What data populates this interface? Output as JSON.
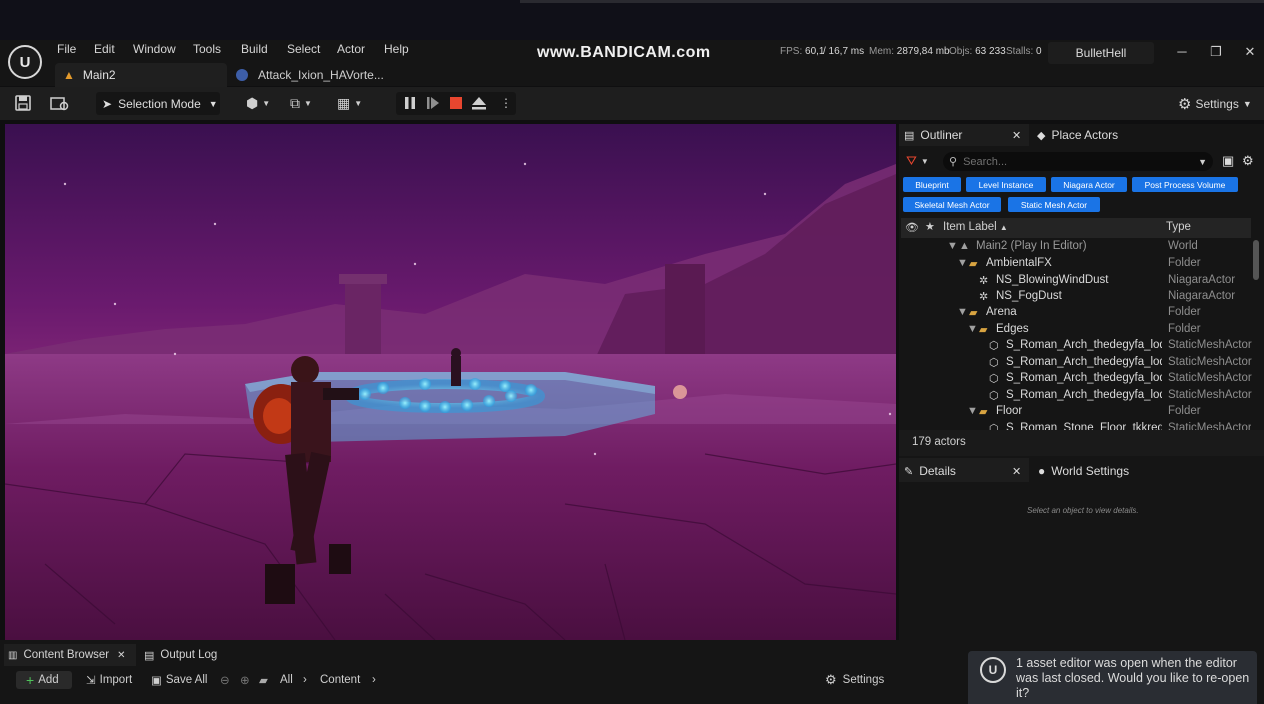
{
  "menu": [
    "File",
    "Edit",
    "Window",
    "Tools",
    "Build",
    "Select",
    "Actor",
    "Help"
  ],
  "tabs": {
    "main": "Main2",
    "attack": "Attack_Ixion_HAVorte..."
  },
  "watermark": "www.BANDICAM.com",
  "stats": {
    "fps_label": "FPS:",
    "fps": "60,1",
    "ms": "/ 16,7 ms",
    "mem_label": "Mem:",
    "mem": "2879,84 mb",
    "objs_label": "Objs:",
    "objs": "63 233",
    "stalls_label": "Stalls:",
    "stalls": "0"
  },
  "project_name": "BulletHell",
  "window_buttons": {
    "minimize": "─",
    "restore": "❐",
    "close": "✕"
  },
  "toolbar": {
    "selection_mode": "Selection Mode",
    "settings": "Settings"
  },
  "outliner": {
    "tab": "Outliner",
    "place_actors_tab": "Place Actors",
    "search_placeholder": "Search...",
    "filters_row1": [
      "Blueprint",
      "Level Instance",
      "Niagara Actor",
      "Post Process Volume"
    ],
    "filters_row2": [
      "Skeletal Mesh Actor",
      "Static Mesh Actor"
    ],
    "columns": {
      "label": "Item Label",
      "type": "Type"
    },
    "rows": [
      {
        "label": "Main2 (Play In Editor)",
        "type": "World"
      },
      {
        "label": "AmbientalFX",
        "type": "Folder"
      },
      {
        "label": "NS_BlowingWindDust",
        "type": "NiagaraActor"
      },
      {
        "label": "NS_FogDust",
        "type": "NiagaraActor"
      },
      {
        "label": "Arena",
        "type": "Folder"
      },
      {
        "label": "Edges",
        "type": "Folder"
      },
      {
        "label": "S_Roman_Arch_thedegyfa_lod",
        "type": "StaticMeshActor"
      },
      {
        "label": "S_Roman_Arch_thedegyfa_lod",
        "type": "StaticMeshActor"
      },
      {
        "label": "S_Roman_Arch_thedegyfa_lod",
        "type": "StaticMeshActor"
      },
      {
        "label": "S_Roman_Arch_thedegyfa_lod",
        "type": "StaticMeshActor"
      },
      {
        "label": "Floor",
        "type": "Folder"
      },
      {
        "label": "S_Roman_Stone_Floor_tkkrequ",
        "type": "StaticMeshActor"
      }
    ],
    "actor_count": "179 actors"
  },
  "details": {
    "tab": "Details",
    "world_settings_tab": "World Settings",
    "hint": "Select an object to view details."
  },
  "bottom": {
    "content_browser_tab": "Content Browser",
    "output_log_tab": "Output Log",
    "add": "Add",
    "import": "Import",
    "save_all": "Save All",
    "path": [
      "All",
      "Content"
    ],
    "settings": "Settings"
  },
  "toast": {
    "text": "1 asset editor was open when the editor was last closed. Would you like to re-open it?"
  },
  "colors": {
    "accent_blue": "#1a74e6",
    "stop_red": "#e8462f",
    "level_orange": "#e39a2c"
  },
  "icons": [
    "unreal-logo-icon",
    "level-icon",
    "blueprint-icon",
    "save-icon",
    "content-icon",
    "add-actor-icon",
    "blueprint-graph-icon",
    "cinematics-icon",
    "pause-icon",
    "step-icon",
    "stop-icon",
    "eject-icon",
    "more-icon",
    "gear-icon",
    "filter-icon",
    "search-icon",
    "add-folder-icon",
    "eye-icon",
    "star-icon",
    "folder-icon",
    "niagara-icon",
    "mesh-icon",
    "globe-icon",
    "close-icon",
    "plus-icon",
    "import-icon",
    "history-back-icon",
    "history-forward-icon",
    "chevron-right-icon"
  ]
}
